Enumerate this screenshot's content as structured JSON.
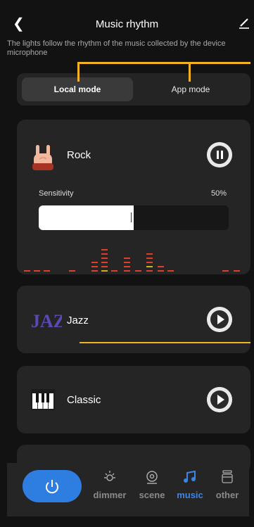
{
  "header": {
    "title": "Music rhythm",
    "subtitle": "The lights follow the rhythm of the music collected by the device microphone"
  },
  "modes": [
    {
      "label": "Local mode",
      "selected": true
    },
    {
      "label": "App mode",
      "selected": false
    }
  ],
  "rhythms": [
    {
      "name": "Rock",
      "icon": "rock-hand-icon",
      "state": "playing",
      "control": "pause-icon"
    },
    {
      "name": "Jazz",
      "icon": "jazz-logo-icon",
      "logo_text": "JAZZ",
      "state": "stopped",
      "control": "play-icon"
    },
    {
      "name": "Classic",
      "icon": "piano-keys-icon",
      "state": "stopped",
      "control": "play-icon"
    }
  ],
  "sensitivity": {
    "label": "Sensitivity",
    "value_text": "50%",
    "value": 0.5
  },
  "nav": {
    "items": [
      {
        "label": "dimmer",
        "icon": "sun-icon",
        "active": false
      },
      {
        "label": "scene",
        "icon": "scene-target-icon",
        "active": false
      },
      {
        "label": "music",
        "icon": "music-note-icon",
        "active": true
      },
      {
        "label": "other",
        "icon": "other-stack-icon",
        "active": false
      }
    ]
  },
  "colors": {
    "background": "#121212",
    "card": "#252525",
    "accent_blue": "#2d7ee0",
    "annotation": "#f3b321",
    "eq_red": "#d8402f",
    "eq_yellow": "#c9b31c"
  }
}
